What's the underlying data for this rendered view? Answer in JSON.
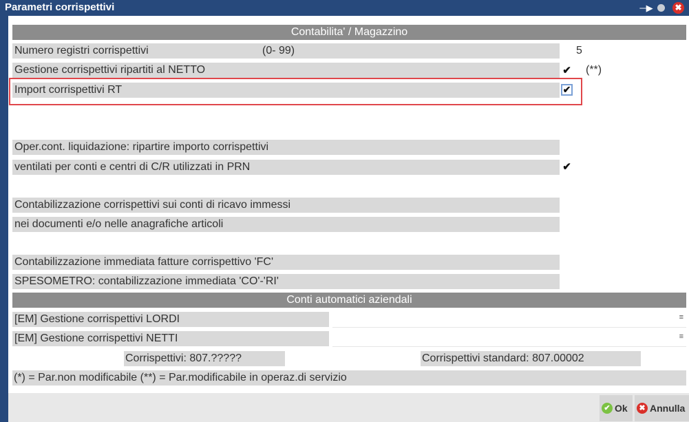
{
  "window": {
    "title": "Parametri corrispettivi",
    "pin_icon": "pin-icon",
    "minimize_icon": "circle-icon",
    "close_icon": "close-icon"
  },
  "sections": {
    "contabilita": "Contabilita' / Magazzino",
    "conti": "Conti automatici aziendali"
  },
  "fields": {
    "numero_registri": {
      "label": "Numero registri corrispettivi",
      "range": "(0- 99)",
      "value": "5"
    },
    "gestione_netto": {
      "label": "Gestione corrispettivi ripartiti al NETTO",
      "checked": true,
      "note": "(**)"
    },
    "import_rt": {
      "label": "Import corrispettivi RT",
      "checked": true
    },
    "oper_cont_1": {
      "label": "Oper.cont. liquidazione: ripartire importo corrispettivi"
    },
    "oper_cont_2": {
      "label": "ventilati per conti e centri di C/R utilizzati in PRN",
      "checked": true
    },
    "contab_ricavo_1": {
      "label": "Contabilizzazione corrispettivi sui conti di ricavo immessi"
    },
    "contab_ricavo_2": {
      "label": "nei documenti e/o nelle anagrafiche articoli",
      "checked": false
    },
    "contab_fc": {
      "label": "Contabilizzazione immediata fatture corrispettivo 'FC'",
      "checked": false
    },
    "spesometro": {
      "label": "SPESOMETRO: contabilizzazione immediata 'CO'-'RI'",
      "checked": false
    },
    "em_lordi": {
      "label": "[EM] Gestione corrispettivi LORDI",
      "value": ""
    },
    "em_netti": {
      "label": "[EM] Gestione corrispettivi NETTI",
      "value": ""
    },
    "corrispettivi": "Corrispettivi: 807.?????",
    "corrispettivi_standard": "Corrispettivi standard: 807.00002",
    "legend": "(*) = Par.non modificabile   (**) = Par.modificabile in operaz.di servizio"
  },
  "check_glyph": "✔",
  "menu_glyph": "≡",
  "buttons": {
    "ok": "Ok",
    "annulla": "Annulla"
  },
  "colors": {
    "titlebar": "#27497c",
    "section_header": "#8c8c8c",
    "row_bg": "#d9d9d9",
    "highlight": "#e0474b",
    "ok_icon": "#7cc243",
    "annulla_icon": "#d9302a"
  }
}
